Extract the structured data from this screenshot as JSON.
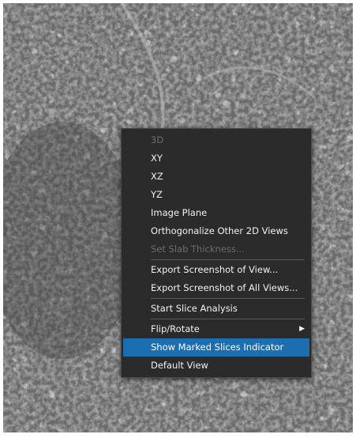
{
  "context_menu": {
    "items": [
      {
        "label": "3D",
        "enabled": false
      },
      {
        "label": "XY",
        "enabled": true
      },
      {
        "label": "XZ",
        "enabled": true
      },
      {
        "label": "YZ",
        "enabled": true
      },
      {
        "label": "Image Plane",
        "enabled": true
      },
      {
        "label": "Orthogonalize Other 2D Views",
        "enabled": true
      },
      {
        "label": "Set Slab Thickness...",
        "enabled": false
      },
      {
        "label": "Export Screenshot of View...",
        "enabled": true
      },
      {
        "label": "Export Screenshot of All Views...",
        "enabled": true
      },
      {
        "label": "Start Slice Analysis",
        "enabled": true
      },
      {
        "label": "Flip/Rotate",
        "enabled": true,
        "submenu": true
      },
      {
        "label": "Show Marked Slices Indicator",
        "enabled": true,
        "selected": true
      },
      {
        "label": "Default View",
        "enabled": true
      }
    ],
    "submenu_arrow_icon": "chevron-right-icon",
    "colors": {
      "background": "#2b2b2b",
      "highlight": "#1b6fb1",
      "disabled_text": "#6e6e6e"
    }
  }
}
